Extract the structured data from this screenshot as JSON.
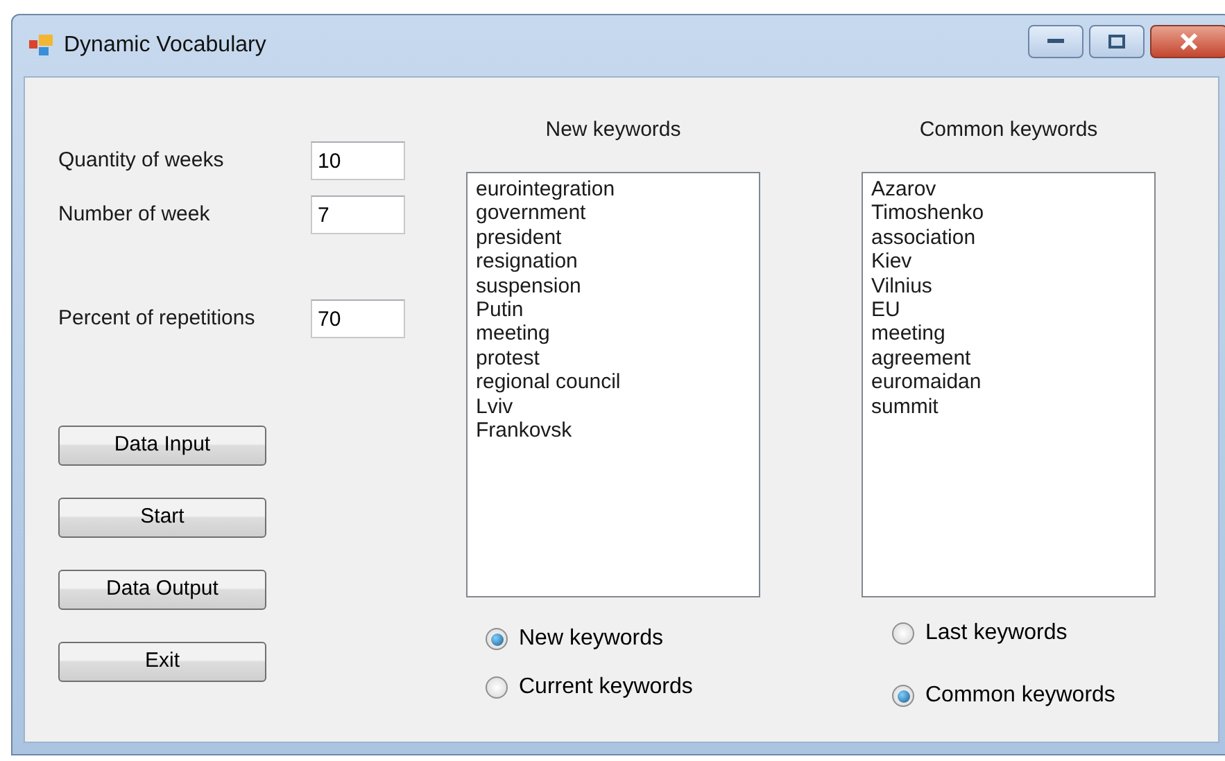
{
  "window": {
    "title": "Dynamic Vocabulary"
  },
  "settings": [
    {
      "label": "Quantity of weeks",
      "value": "10"
    },
    {
      "label": "Number of week",
      "value": "7"
    },
    {
      "label": "Percent of repetitions",
      "value": "70"
    }
  ],
  "buttons": [
    "Data Input",
    "Start",
    "Data Output",
    "Exit"
  ],
  "lists": [
    {
      "heading": "New keywords",
      "items": [
        "eurointegration",
        "government",
        "president",
        "resignation",
        "suspension",
        "Putin",
        "meeting",
        "protest",
        "regional council",
        "Lviv",
        "Frankovsk"
      ],
      "radios": [
        {
          "label": "New keywords",
          "selected": true
        },
        {
          "label": "Current keywords",
          "selected": false
        }
      ]
    },
    {
      "heading": "Common keywords",
      "items": [
        "Azarov",
        "Timoshenko",
        "association",
        "Kiev",
        "Vilnius",
        "EU",
        "meeting",
        "agreement",
        "euromaidan",
        "summit"
      ],
      "radios": [
        {
          "label": "Last keywords",
          "selected": false
        },
        {
          "label": "Common keywords",
          "selected": true
        }
      ]
    }
  ]
}
